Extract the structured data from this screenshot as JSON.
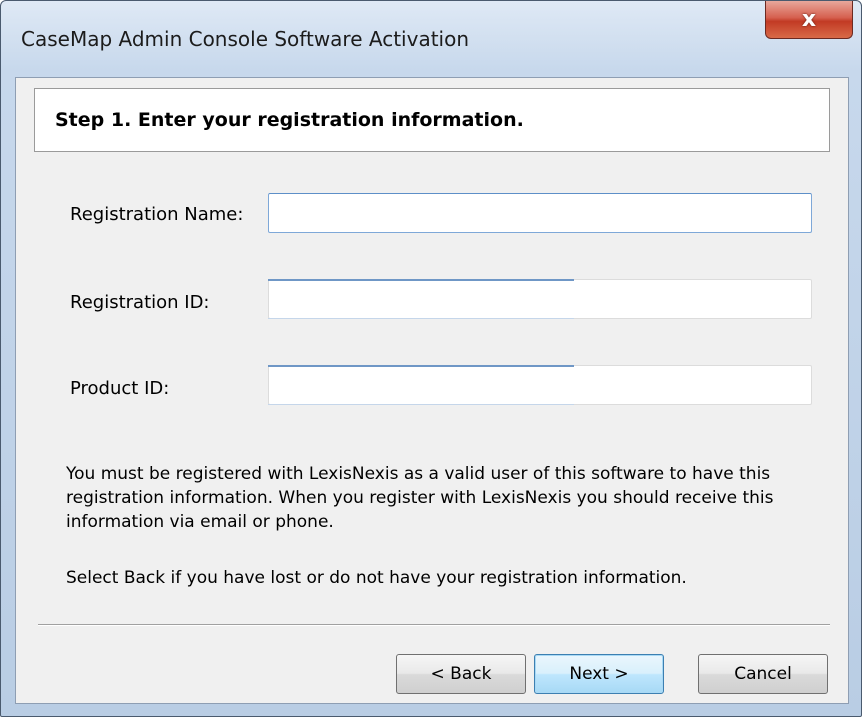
{
  "window": {
    "title": "CaseMap Admin Console Software Activation",
    "close_glyph": "x"
  },
  "header": {
    "step_title": "Step 1. Enter your registration information."
  },
  "form": {
    "registration_name": {
      "label": "Registration Name:",
      "value": ""
    },
    "registration_id": {
      "label": "Registration ID:",
      "value": ""
    },
    "product_id": {
      "label": "Product ID:",
      "value": ""
    }
  },
  "info": {
    "paragraph1": "You must be registered with LexisNexis as a valid user of this software to have this registration information.  When you register with LexisNexis you should receive this information via email or phone.",
    "paragraph2": "Select Back if you have lost or do not have your registration information."
  },
  "buttons": {
    "back_label": "< Back",
    "next_label": "Next >",
    "cancel_label": "Cancel"
  },
  "colors": {
    "title_bar": "#c7d8ec",
    "close_button": "#c23a24",
    "client_bg": "#f0f0f0",
    "default_button": "#bee6fd"
  }
}
